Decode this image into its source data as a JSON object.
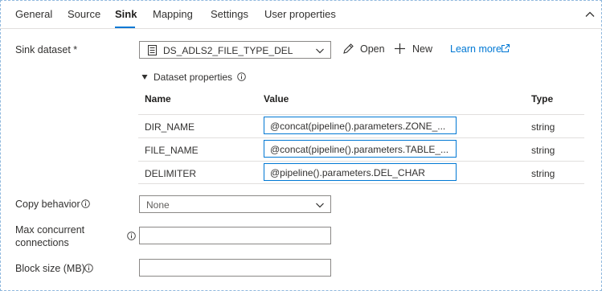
{
  "tabs": [
    "General",
    "Source",
    "Sink",
    "Mapping",
    "Settings",
    "User properties"
  ],
  "active_tab": "Sink",
  "sink_dataset": {
    "label": "Sink dataset *",
    "selected": "DS_ADLS2_FILE_TYPE_DEL",
    "open_label": "Open",
    "new_label": "New",
    "learn_more_label": "Learn more"
  },
  "dataset_properties": {
    "title": "Dataset properties",
    "headers": {
      "name": "Name",
      "value": "Value",
      "type": "Type"
    },
    "rows": [
      {
        "name": "DIR_NAME",
        "value": "@concat(pipeline().parameters.ZONE_...",
        "type": "string"
      },
      {
        "name": "FILE_NAME",
        "value": "@concat(pipeline().parameters.TABLE_...",
        "type": "string"
      },
      {
        "name": "DELIMITER",
        "value": "@pipeline().parameters.DEL_CHAR",
        "type": "string"
      }
    ]
  },
  "copy_behavior": {
    "label": "Copy behavior",
    "selected": "None"
  },
  "max_concurrent": {
    "label_line1": "Max concurrent",
    "label_line2": "connections",
    "value": ""
  },
  "block_size": {
    "label": "Block size (MB)",
    "value": ""
  },
  "colors": {
    "accent": "#0078d4",
    "text": "#323130",
    "border": "#8a8886"
  }
}
